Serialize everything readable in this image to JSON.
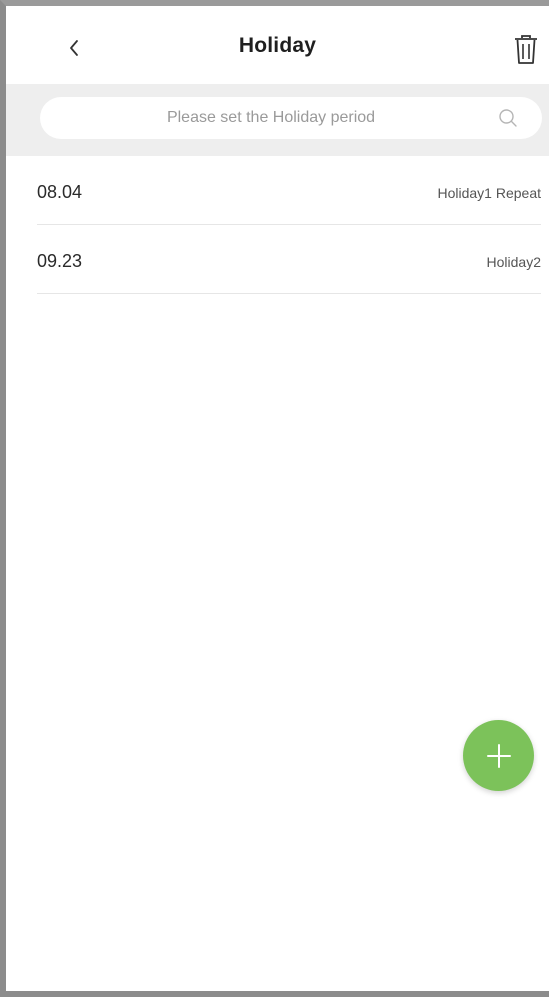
{
  "header": {
    "back_icon": "chevron-left-icon",
    "title": "Holiday",
    "delete_icon": "trash-icon"
  },
  "search": {
    "placeholder": "Please set the Holiday period",
    "icon": "search-icon"
  },
  "holidays": [
    {
      "date": "08.04",
      "info": "Holiday1 Repeat"
    },
    {
      "date": "09.23",
      "info": "Holiday2"
    }
  ],
  "fab": {
    "icon": "plus-icon"
  },
  "colors": {
    "accent": "#7cc25a",
    "search_band": "#eeeeee",
    "divider": "#e6e6e6"
  }
}
